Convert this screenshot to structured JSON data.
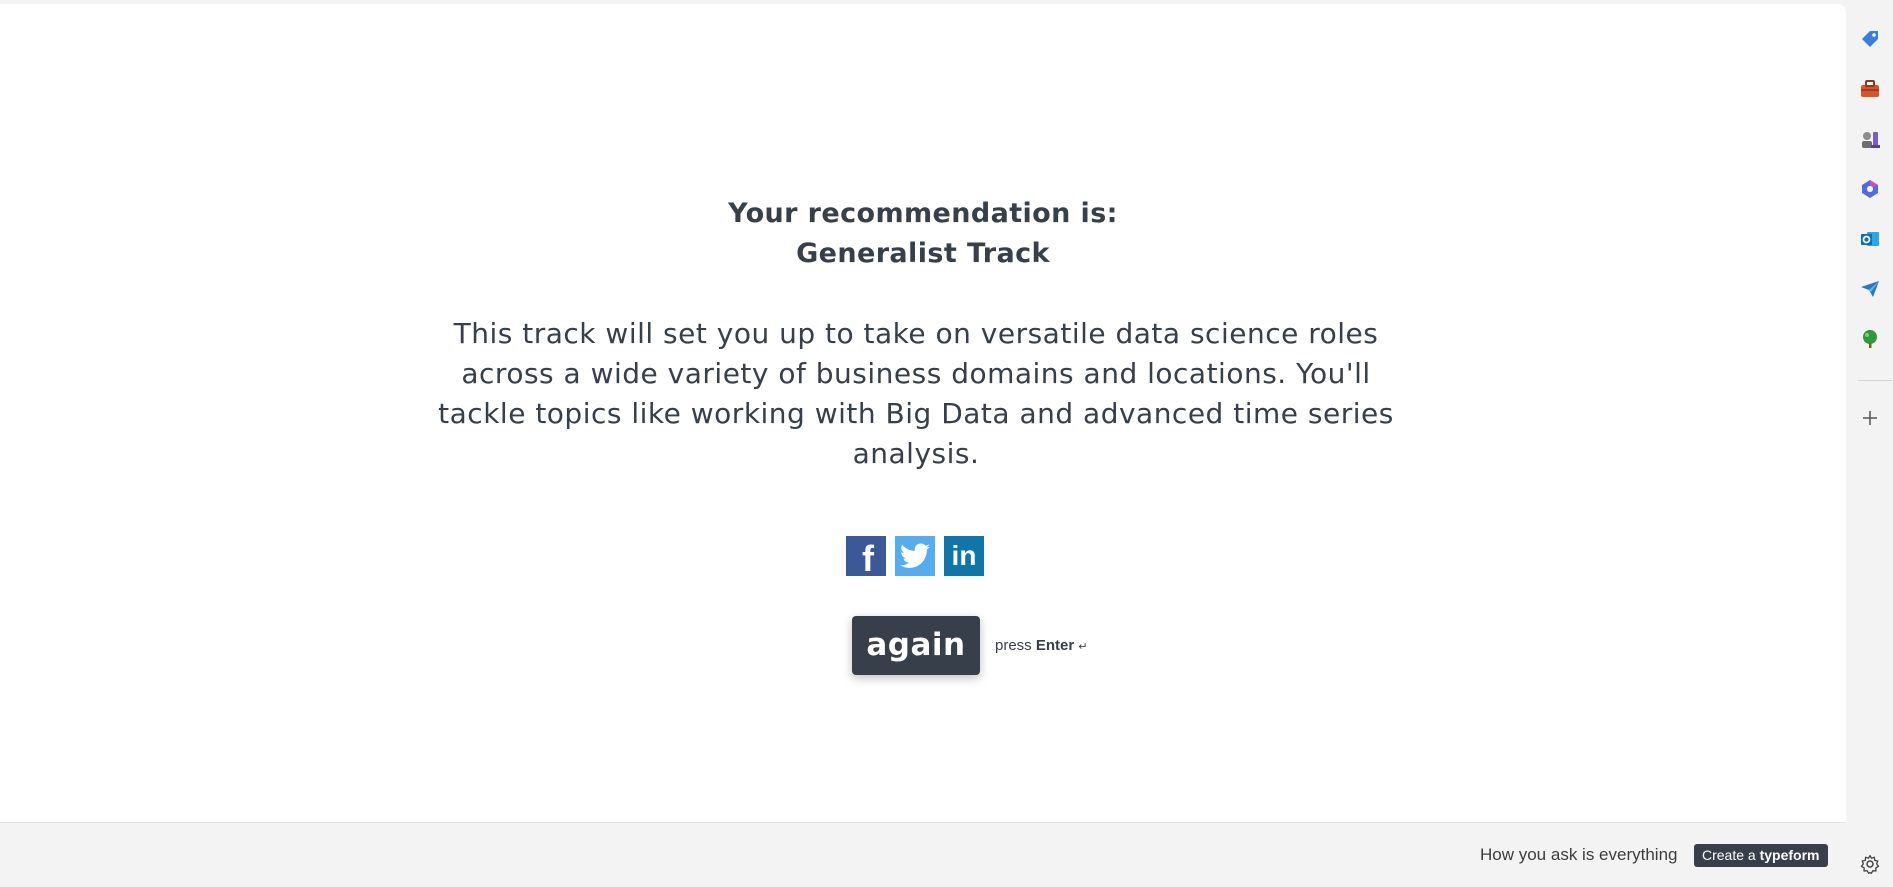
{
  "result": {
    "heading_line1": "Your recommendation is:",
    "heading_line2": "Generalist Track",
    "description": "This track will set you up to take on versatile data science roles across a wide variety of business domains and locations. You'll tackle topics like working with Big Data and advanced time series analysis."
  },
  "share": {
    "facebook_icon": "facebook-icon",
    "twitter_icon": "twitter-icon",
    "linkedin_icon": "linkedin-icon",
    "facebook_letter": "f",
    "linkedin_letters": "in"
  },
  "actions": {
    "again_label": "again",
    "hint_prefix": "press",
    "hint_key": "Enter",
    "hint_symbol": "↵"
  },
  "footer": {
    "tagline": "How you ask is everything",
    "create_prefix": "Create a",
    "create_brand": "typeform"
  },
  "sidebar": {
    "items": [
      {
        "icon": "tag-icon",
        "color": "#3b7de0"
      },
      {
        "icon": "briefcase-icon",
        "color": "#d9532b"
      },
      {
        "icon": "chess-icon",
        "color": "#7b5cc4"
      },
      {
        "icon": "copilot-icon",
        "color": "#4b6fe0"
      },
      {
        "icon": "outlook-icon",
        "color": "#0f6cbd"
      },
      {
        "icon": "send-icon",
        "color": "#1f78c8"
      },
      {
        "icon": "tree-icon",
        "color": "#2e9a3a"
      }
    ],
    "add_icon": "plus-icon",
    "settings_icon": "gear-icon"
  }
}
